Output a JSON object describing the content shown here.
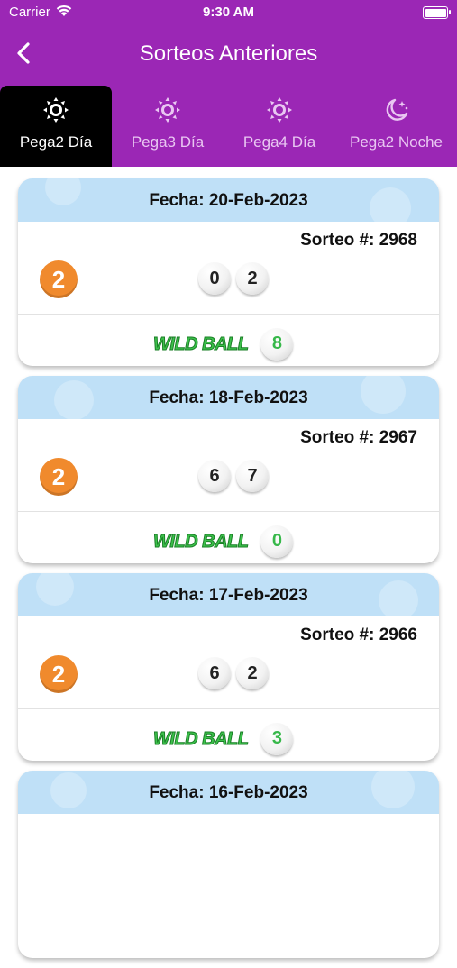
{
  "status_bar": {
    "carrier": "Carrier",
    "time": "9:30 AM"
  },
  "nav": {
    "title": "Sorteos Anteriores"
  },
  "tabs": [
    {
      "label": "Pega2 Día",
      "icon": "sun-icon",
      "active": true
    },
    {
      "label": "Pega3 Día",
      "icon": "sun-icon",
      "active": false
    },
    {
      "label": "Pega4 Día",
      "icon": "sun-icon",
      "active": false
    },
    {
      "label": "Pega2 Noche",
      "icon": "moon-stars-icon",
      "active": false
    }
  ],
  "colors": {
    "header": "#9b27b5",
    "active_tab": "#000000",
    "card_header": "#bfe0f7",
    "badge": "#f08a2d",
    "wild": "#3cc14b"
  },
  "wild_label": "WILD BALL",
  "draws": [
    {
      "fecha": "Fecha: 20-Feb-2023",
      "sorteo": "Sorteo #: 2968",
      "badge": "2",
      "balls": [
        "0",
        "2"
      ],
      "wild": "8"
    },
    {
      "fecha": "Fecha: 18-Feb-2023",
      "sorteo": "Sorteo #: 2967",
      "badge": "2",
      "balls": [
        "6",
        "7"
      ],
      "wild": "0"
    },
    {
      "fecha": "Fecha: 17-Feb-2023",
      "sorteo": "Sorteo #: 2966",
      "badge": "2",
      "balls": [
        "6",
        "2"
      ],
      "wild": "3"
    },
    {
      "fecha": "Fecha: 16-Feb-2023"
    }
  ]
}
